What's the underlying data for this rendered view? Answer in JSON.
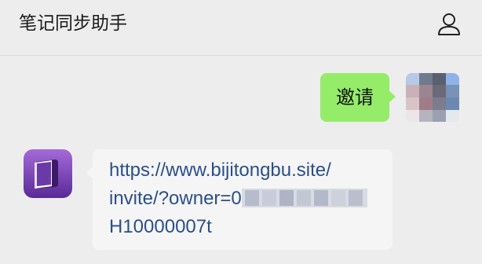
{
  "header": {
    "title": "笔记同步助手",
    "profile_icon": "user-profile-icon"
  },
  "messages": [
    {
      "side": "right",
      "text": "邀请"
    },
    {
      "side": "left",
      "link_line1": "https://www.bijitongbu.site/",
      "link_line2_prefix": "invite/?owner=0",
      "link_line3": "H10000007t"
    }
  ],
  "colors": {
    "background": "#ededed",
    "sent_bubble": "#95ec69",
    "received_bubble": "#f5f5f5",
    "link": "#2b4f8a"
  }
}
